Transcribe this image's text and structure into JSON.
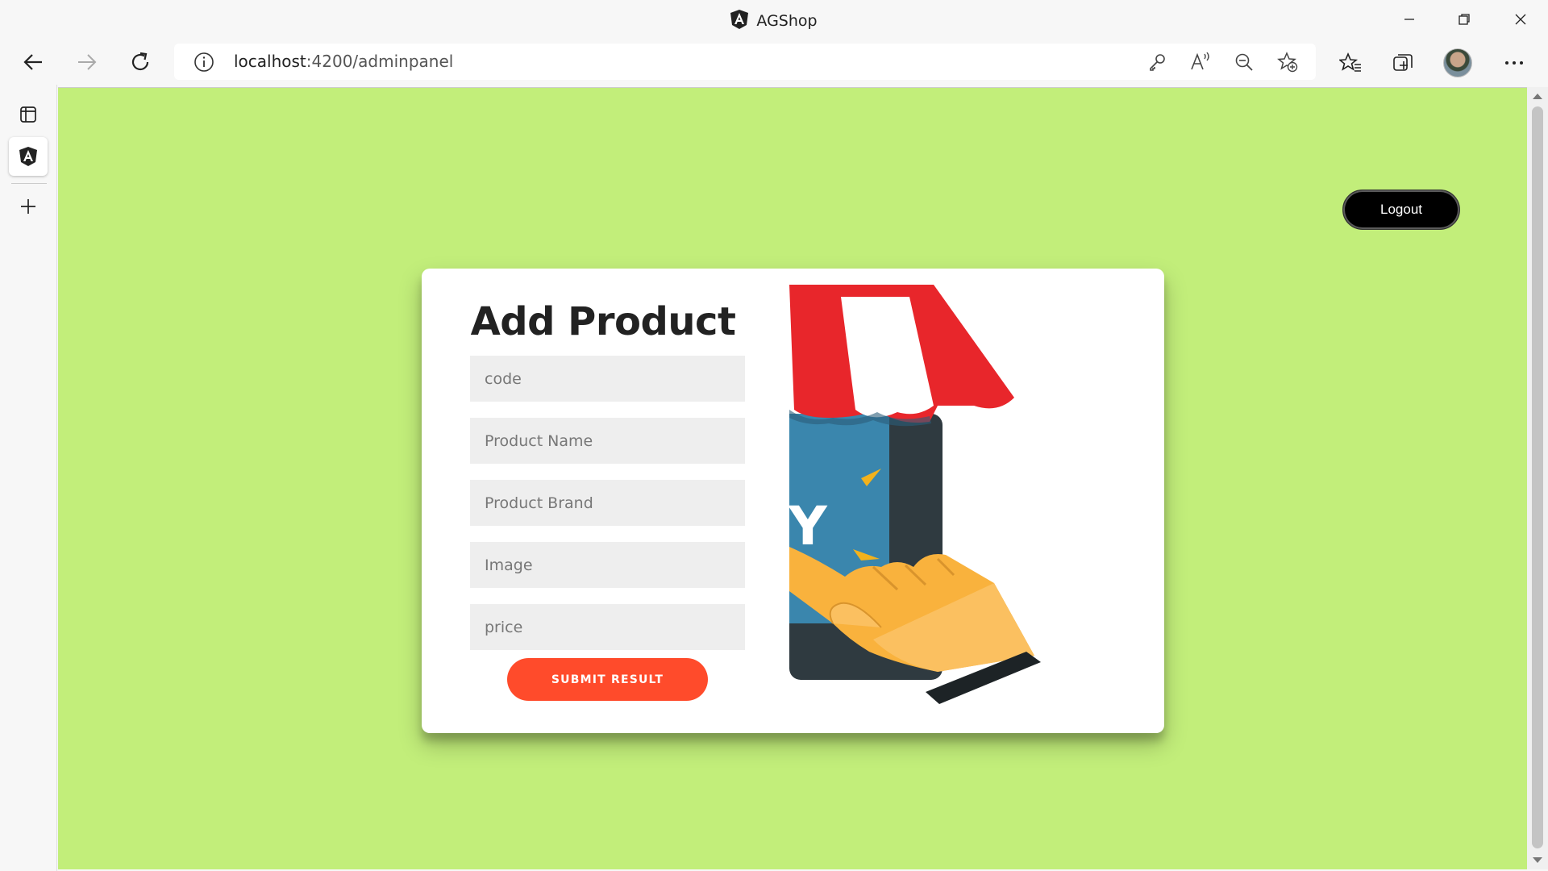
{
  "window": {
    "title": "AGShop"
  },
  "toolbar": {
    "url_host": "localhost",
    "url_rest": ":4200/adminpanel"
  },
  "page": {
    "logout_label": "Logout",
    "heading": "Add Product",
    "fields": {
      "code": "code",
      "name": "Product Name",
      "brand": "Product Brand",
      "image": "Image",
      "price": "price"
    },
    "submit_label": "SUBMIT RESULT",
    "illustration_letter": "Y"
  },
  "colors": {
    "page_bg": "#c2ee7a",
    "accent": "#ff4b2b",
    "card_bg": "#ffffff",
    "logout_bg": "#000000"
  },
  "icons": [
    "angular-logo-icon",
    "minimize-icon",
    "restore-icon",
    "close-icon",
    "back-arrow-icon",
    "forward-arrow-icon",
    "refresh-icon",
    "info-icon",
    "key-icon",
    "read-aloud-icon",
    "zoom-out-icon",
    "add-favorite-icon",
    "favorites-icon",
    "collections-icon",
    "more-icon",
    "tab-actions-icon",
    "plus-icon"
  ]
}
